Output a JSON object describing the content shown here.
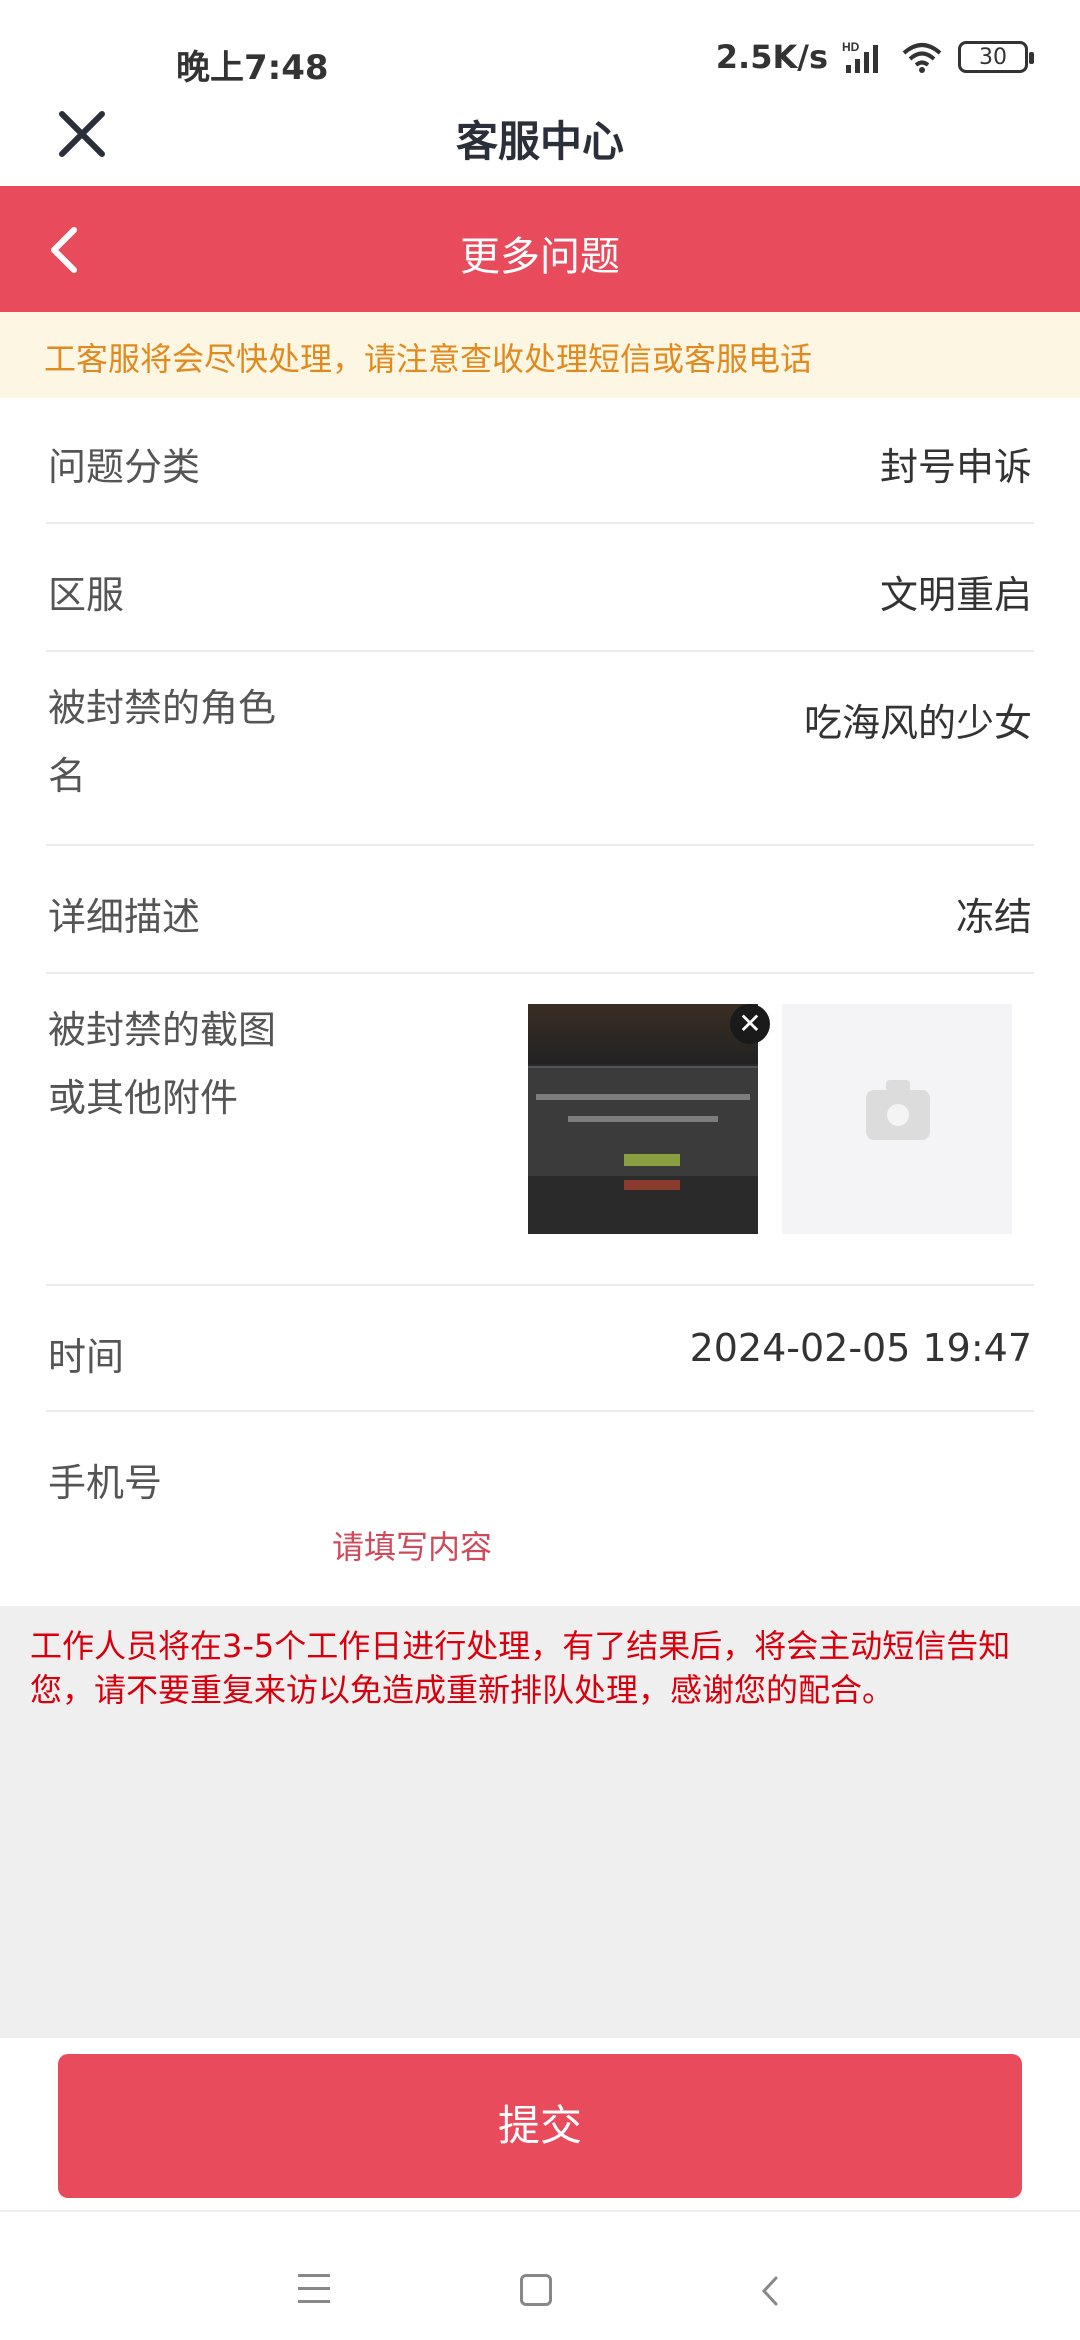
{
  "status": {
    "time": "晚上7:48",
    "speed": "2.5K/s",
    "network": "HD",
    "battery": "30"
  },
  "topbar": {
    "title": "客服中心"
  },
  "header": {
    "title": "更多问题"
  },
  "notice": "工客服将会尽快处理，请注意查收处理短信或客服电话",
  "form": {
    "category": {
      "label": "问题分类",
      "value": "封号申诉"
    },
    "server": {
      "label": "区服",
      "value": "文明重启"
    },
    "role": {
      "label": "被封禁的角色名",
      "value": "吃海风的少女"
    },
    "detail": {
      "label": "详细描述",
      "value": "冻结"
    },
    "attachment": {
      "label": "被封禁的截图或其他附件"
    },
    "time": {
      "label": "时间",
      "value": "2024-02-05 19:47"
    },
    "phone": {
      "label": "手机号",
      "placeholder": "请填写内容"
    }
  },
  "info_text": "工作人员将在3-5个工作日进行处理，有了结果后，将会主动短信告知您，请不要重复来访以免造成重新排队处理，感谢您的配合。",
  "submit_label": "提交",
  "colors": {
    "accent": "#e84c5c",
    "notice_text": "#e08a1f",
    "notice_bg": "#fdf6e2",
    "warning_text": "#d9000d"
  }
}
